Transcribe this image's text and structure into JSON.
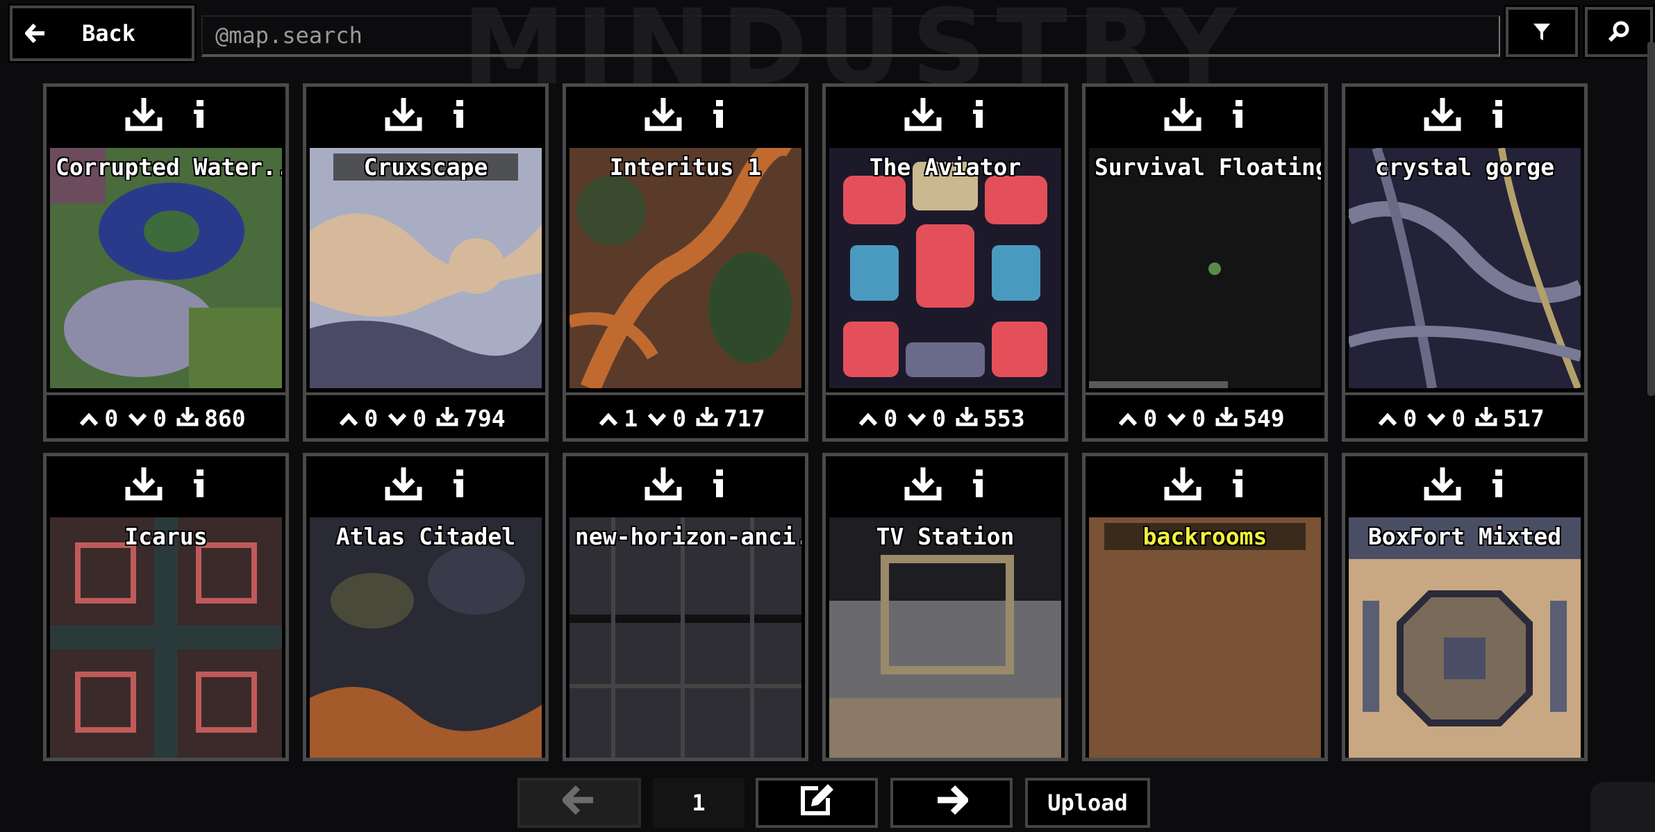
{
  "background_title": "MINDUSTRY",
  "header": {
    "back_label": "Back",
    "search_placeholder": "@map.search",
    "filter_icon": "filter-icon",
    "search_icon": "search-icon"
  },
  "maps": [
    {
      "title": "Corrupted Water...",
      "upvotes": "0",
      "downvotes": "0",
      "downloads": "860",
      "style": "plain"
    },
    {
      "title": "Cruxscape",
      "upvotes": "0",
      "downvotes": "0",
      "downloads": "794",
      "style": "bar"
    },
    {
      "title": "Interitus 1",
      "upvotes": "1",
      "downvotes": "0",
      "downloads": "717",
      "style": "plain"
    },
    {
      "title": "The Aviator",
      "upvotes": "0",
      "downvotes": "0",
      "downloads": "553",
      "style": "plain"
    },
    {
      "title": "Survival Floating ...",
      "upvotes": "0",
      "downvotes": "0",
      "downloads": "549",
      "style": "plain"
    },
    {
      "title": "crystal gorge",
      "upvotes": "0",
      "downvotes": "0",
      "downloads": "517",
      "style": "plain"
    },
    {
      "title": "Icarus",
      "style": "plain"
    },
    {
      "title": "Atlas  Citadel",
      "style": "plain"
    },
    {
      "title": "new-horizon-anci...",
      "style": "plain"
    },
    {
      "title": "TV Station",
      "style": "plain"
    },
    {
      "title": "backrooms",
      "style": "yellow"
    },
    {
      "title": "BoxFort Mixted",
      "style": "plain"
    }
  ],
  "pager": {
    "page": "1",
    "upload_label": "Upload"
  },
  "colors": {
    "panel_border": "#4a4a4a",
    "title_yellow": "#f3f33a",
    "background": "#0c0c0e"
  }
}
